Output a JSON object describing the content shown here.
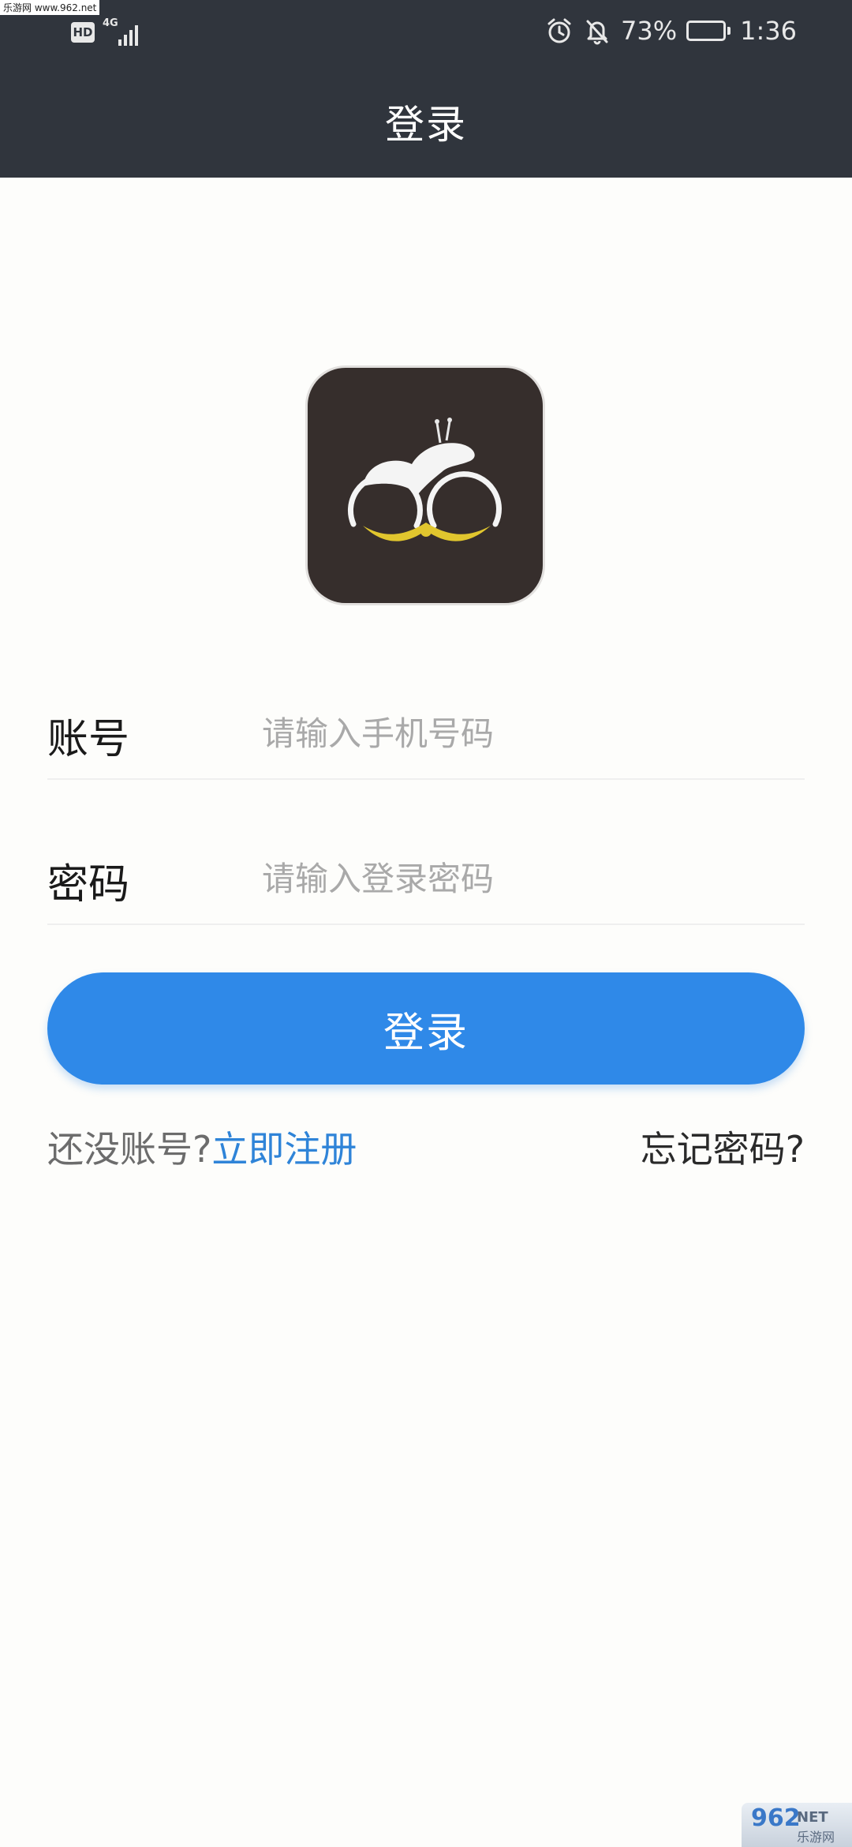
{
  "watermark_top": "乐游网 www.962.net",
  "status_bar": {
    "hd_label": "HD",
    "network_label": "4G",
    "battery_text": "73%",
    "battery_level": 0.73,
    "time": "1:36",
    "icons": [
      "alarm-icon",
      "bell-muted-icon",
      "battery-icon"
    ]
  },
  "app_bar": {
    "title": "登录"
  },
  "form": {
    "account": {
      "label": "账号",
      "placeholder": "请输入手机号码"
    },
    "password": {
      "label": "密码",
      "placeholder": "请输入登录密码"
    },
    "login_button": "登录"
  },
  "links": {
    "no_account": "还没账号?",
    "register": "立即注册",
    "forgot": "忘记密码?"
  },
  "colors": {
    "topbar": "#30353d",
    "primary": "#2f89e8",
    "link": "#2f84d8",
    "logo_bg": "#362e2c"
  },
  "watermark_bottom": {
    "big": "962",
    "net": "NET",
    "cn": "乐游网"
  }
}
